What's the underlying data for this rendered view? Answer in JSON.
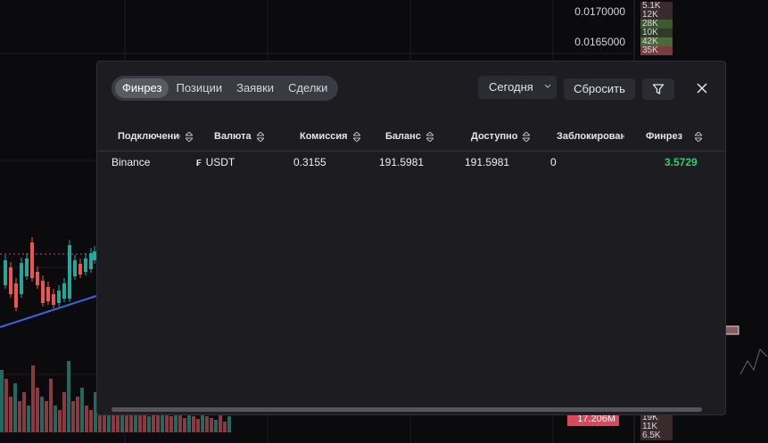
{
  "background": {
    "price_labels": [
      "0.0170000",
      "0.0165000"
    ],
    "order_book_top": [
      {
        "text": "5.1K",
        "color": "#3a2a2e"
      },
      {
        "text": "12K",
        "color": "#3a2a2e"
      },
      {
        "text": "28K",
        "color": "#3b5a2e"
      },
      {
        "text": "10K",
        "color": "#2e3a2a"
      },
      {
        "text": "42K",
        "color": "#4a6a3a"
      },
      {
        "text": "35K",
        "color": "#7a3a3e"
      }
    ],
    "order_book_bottom": [
      {
        "text": "19K",
        "color": "#3a2a2e"
      },
      {
        "text": "11K",
        "color": "#3a2a2e"
      },
      {
        "text": "6.5K",
        "color": "#3a2a2e"
      }
    ],
    "volume_label": "17.206M"
  },
  "modal": {
    "tabs": [
      {
        "label": "Финрез",
        "active": true
      },
      {
        "label": "Позиции",
        "active": false
      },
      {
        "label": "Заявки",
        "active": false
      },
      {
        "label": "Сделки",
        "active": false
      }
    ],
    "period": {
      "selected": "Сегодня"
    },
    "reset_label": "Сбросить",
    "filter_icon": "filter-icon",
    "close_icon": "close-icon",
    "table": {
      "columns": [
        "Подключение",
        "Валюта",
        "Комиссия",
        "Баланс",
        "Доступно",
        "Заблокировано",
        "Финрез"
      ],
      "rows": [
        {
          "connection": "Binance",
          "exchange_icon": "₣",
          "currency": "USDT",
          "commission": "0.3155",
          "balance": "191.5981",
          "available": "191.5981",
          "blocked": "0",
          "pnl": "3.5729"
        }
      ]
    },
    "accent_green": "#2ecc71"
  }
}
